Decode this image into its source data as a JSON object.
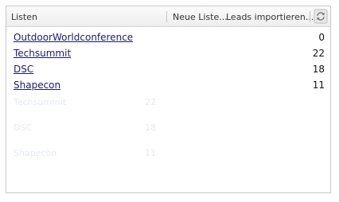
{
  "header": {
    "title": "Listen",
    "new_list_label": "Neue Liste...",
    "import_label": "Leads importieren...",
    "refresh_icon": "refresh-icon"
  },
  "lists": [
    {
      "name": "OutdoorWorldconference",
      "count": "0"
    },
    {
      "name": "Techsummit",
      "count": "22"
    },
    {
      "name": "DSC",
      "count": "18"
    },
    {
      "name": "Shapecon",
      "count": "11"
    }
  ],
  "colors": {
    "link": "#1a1a6e",
    "header_bg": "#f2f2f2",
    "border": "#c8c8c8"
  }
}
